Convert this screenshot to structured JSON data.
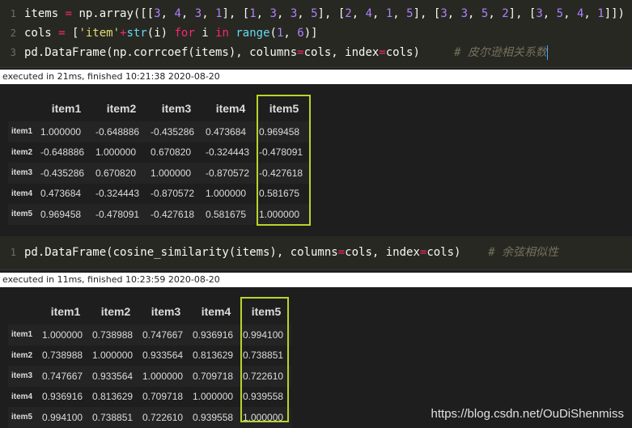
{
  "cell1": {
    "line_numbers": [
      "1",
      "2",
      "3"
    ],
    "line1": {
      "a": "items ",
      "eq": "=",
      "b": " np.array([[",
      "n1": "3",
      "c1": ", ",
      "n2": "4",
      "c2": ", ",
      "n3": "3",
      "c3": ", ",
      "n4": "1",
      "c4": "], [",
      "n5": "1",
      "c5": ", ",
      "n6": "3",
      "c6": ", ",
      "n7": "3",
      "c7": ", ",
      "n8": "5",
      "c8": "], [",
      "n9": "2",
      "c9": ", ",
      "n10": "4",
      "c10": ", ",
      "n11": "1",
      "c11": ", ",
      "n12": "5",
      "c12": "], [",
      "n13": "3",
      "c13": ", ",
      "n14": "3",
      "c14": ", ",
      "n15": "5",
      "c15": ", ",
      "n16": "2",
      "c16": "], [",
      "n17": "3",
      "c17": ", ",
      "n18": "5",
      "c18": ", ",
      "n19": "4",
      "c19": ", ",
      "n20": "1",
      "end": "]])"
    },
    "line2": {
      "a": "cols ",
      "eq": "=",
      "b": " [",
      "s": "'item'",
      "plus": "+",
      "fn": "str",
      "c": "(i) ",
      "kw1": "for",
      "d": " i ",
      "kw2": "in",
      "e": " ",
      "fn2": "range",
      "f": "(",
      "n1": "1",
      "g": ", ",
      "n2": "6",
      "h": ")]"
    },
    "line3": {
      "a": "pd.DataFrame(np.corrcoef(items), columns",
      "eq1": "=",
      "b": "cols, index",
      "eq2": "=",
      "c": "cols)",
      "comment": "# 皮尔逊相关系数"
    }
  },
  "exec1": "executed in 21ms, finished 10:21:38 2020-08-20",
  "table1": {
    "columns": [
      "item1",
      "item2",
      "item3",
      "item4",
      "item5"
    ],
    "rows": [
      {
        "index": "item1",
        "values": [
          "1.000000",
          "-0.648886",
          "-0.435286",
          "0.473684",
          "0.969458"
        ]
      },
      {
        "index": "item2",
        "values": [
          "-0.648886",
          "1.000000",
          "0.670820",
          "-0.324443",
          "-0.478091"
        ]
      },
      {
        "index": "item3",
        "values": [
          "-0.435286",
          "0.670820",
          "1.000000",
          "-0.870572",
          "-0.427618"
        ]
      },
      {
        "index": "item4",
        "values": [
          "0.473684",
          "-0.324443",
          "-0.870572",
          "1.000000",
          "0.581675"
        ]
      },
      {
        "index": "item5",
        "values": [
          "0.969458",
          "-0.478091",
          "-0.427618",
          "0.581675",
          "1.000000"
        ]
      }
    ]
  },
  "cell2": {
    "line_numbers": [
      "1"
    ],
    "line1": {
      "a": "pd.DataFrame(cosine_similarity(items), columns",
      "eq1": "=",
      "b": "cols, index",
      "eq2": "=",
      "c": "cols)",
      "comment": "# 余弦相似性"
    }
  },
  "exec2": "executed in 11ms, finished 10:23:59 2020-08-20",
  "table2": {
    "columns": [
      "item1",
      "item2",
      "item3",
      "item4",
      "item5"
    ],
    "rows": [
      {
        "index": "item1",
        "values": [
          "1.000000",
          "0.738988",
          "0.747667",
          "0.936916",
          "0.994100"
        ]
      },
      {
        "index": "item2",
        "values": [
          "0.738988",
          "1.000000",
          "0.933564",
          "0.813629",
          "0.738851"
        ]
      },
      {
        "index": "item3",
        "values": [
          "0.747667",
          "0.933564",
          "1.000000",
          "0.709718",
          "0.722610"
        ]
      },
      {
        "index": "item4",
        "values": [
          "0.936916",
          "0.813629",
          "0.709718",
          "1.000000",
          "0.939558"
        ]
      },
      {
        "index": "item5",
        "values": [
          "0.994100",
          "0.738851",
          "0.722610",
          "0.939558",
          "1.000000"
        ]
      }
    ]
  },
  "watermark": "https://blog.csdn.net/OuDiShenmiss",
  "colors": {
    "highlight_box": "#b5d62a",
    "code_bg": "#272822",
    "output_bg": "#1e1e1e"
  }
}
